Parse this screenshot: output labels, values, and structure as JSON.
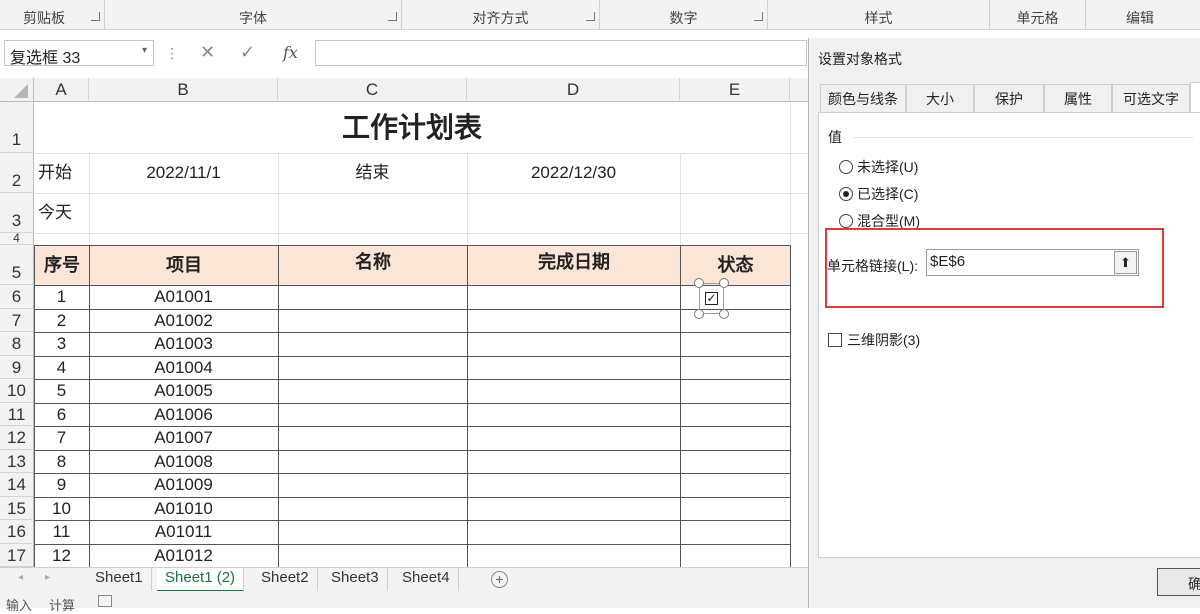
{
  "ribbon": {
    "groups": [
      "剪贴板",
      "字体",
      "对齐方式",
      "数字",
      "样式",
      "单元格",
      "编辑"
    ]
  },
  "formula_bar": {
    "name_box": "复选框 33",
    "cancel_glyph": "✕",
    "enter_glyph": "✓",
    "fx": "fx",
    "formula_value": ""
  },
  "sheet": {
    "columns": [
      "A",
      "B",
      "C",
      "D",
      "E"
    ],
    "title": "工作计划表",
    "row2": {
      "start_label": "开始",
      "start_value": "2022/11/1",
      "end_label": "结束",
      "end_value": "2022/12/30"
    },
    "row3": {
      "today_label": "今天"
    },
    "headers": [
      "序号",
      "项目",
      "名称",
      "完成日期",
      "状态"
    ],
    "rows": [
      [
        "1",
        "A01001"
      ],
      [
        "2",
        "A01002"
      ],
      [
        "3",
        "A01003"
      ],
      [
        "4",
        "A01004"
      ],
      [
        "5",
        "A01005"
      ],
      [
        "6",
        "A01006"
      ],
      [
        "7",
        "A01007"
      ],
      [
        "8",
        "A01008"
      ],
      [
        "9",
        "A01009"
      ],
      [
        "10",
        "A01010"
      ],
      [
        "11",
        "A01011"
      ],
      [
        "12",
        "A01012"
      ]
    ],
    "row_numbers": [
      "1",
      "2",
      "3",
      "4",
      "5",
      "6",
      "7",
      "8",
      "9",
      "10",
      "11",
      "12",
      "13",
      "14",
      "15",
      "16",
      "17"
    ],
    "checkbox_checked": true
  },
  "sheet_tabs": {
    "tabs": [
      "Sheet1",
      "Sheet1 (2)",
      "Sheet2",
      "Sheet3",
      "Sheet4"
    ],
    "active": "Sheet1 (2)",
    "add_glyph": "+"
  },
  "status_bar": {
    "mode": "输入",
    "calc": "计算"
  },
  "dialog": {
    "title": "设置对象格式",
    "tabs": [
      "颜色与线条",
      "大小",
      "保护",
      "属性",
      "可选文字"
    ],
    "active_tab": "",
    "section_label": "值",
    "options": [
      {
        "label": "未选择(U)",
        "selected": false
      },
      {
        "label": "已选择(C)",
        "selected": true
      },
      {
        "label": "混合型(M)",
        "selected": false
      }
    ],
    "cell_link_label": "单元格链接(L):",
    "cell_link_value": "$E$6",
    "shading_label": "三维阴影(3)",
    "ok_label": "确"
  },
  "colors": {
    "header_fill": "#fbe5d6",
    "highlight": "#e23b3b",
    "active_tab": "#1e7145"
  }
}
